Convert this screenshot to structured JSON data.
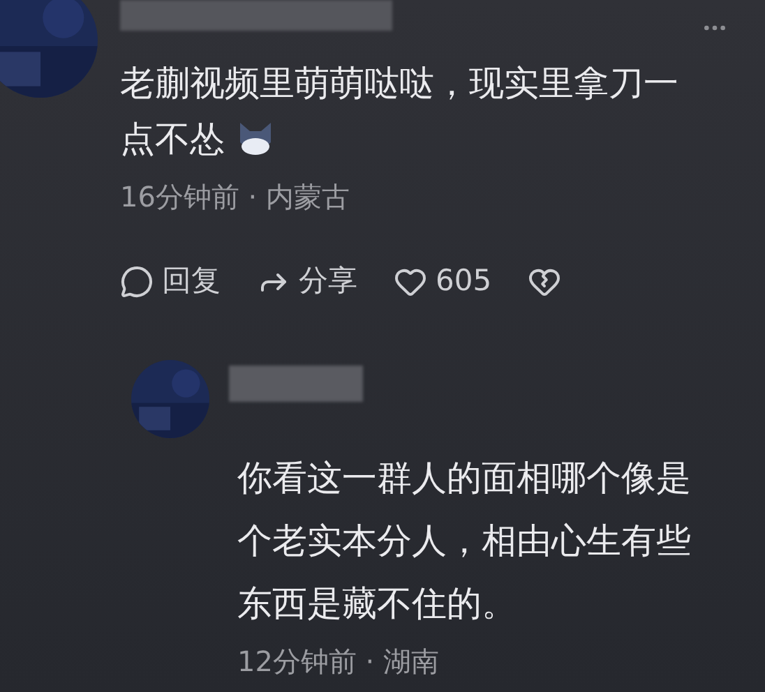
{
  "comments": [
    {
      "text": "老蒯视频里萌萌哒哒，现实里拿刀一点不怂",
      "sticker": true,
      "meta": "16分钟前 · 内蒙古",
      "actions": [
        {
          "kind": "reply",
          "label": "回复"
        },
        {
          "kind": "share",
          "label": "分享"
        },
        {
          "kind": "like",
          "label": "605"
        },
        {
          "kind": "dislike"
        }
      ]
    },
    {
      "text": "你看这一群人的面相哪个像是个老实本分人，相由心生有些东西是藏不住的。",
      "sticker": false,
      "meta": "12分钟前 · 湖南"
    }
  ]
}
